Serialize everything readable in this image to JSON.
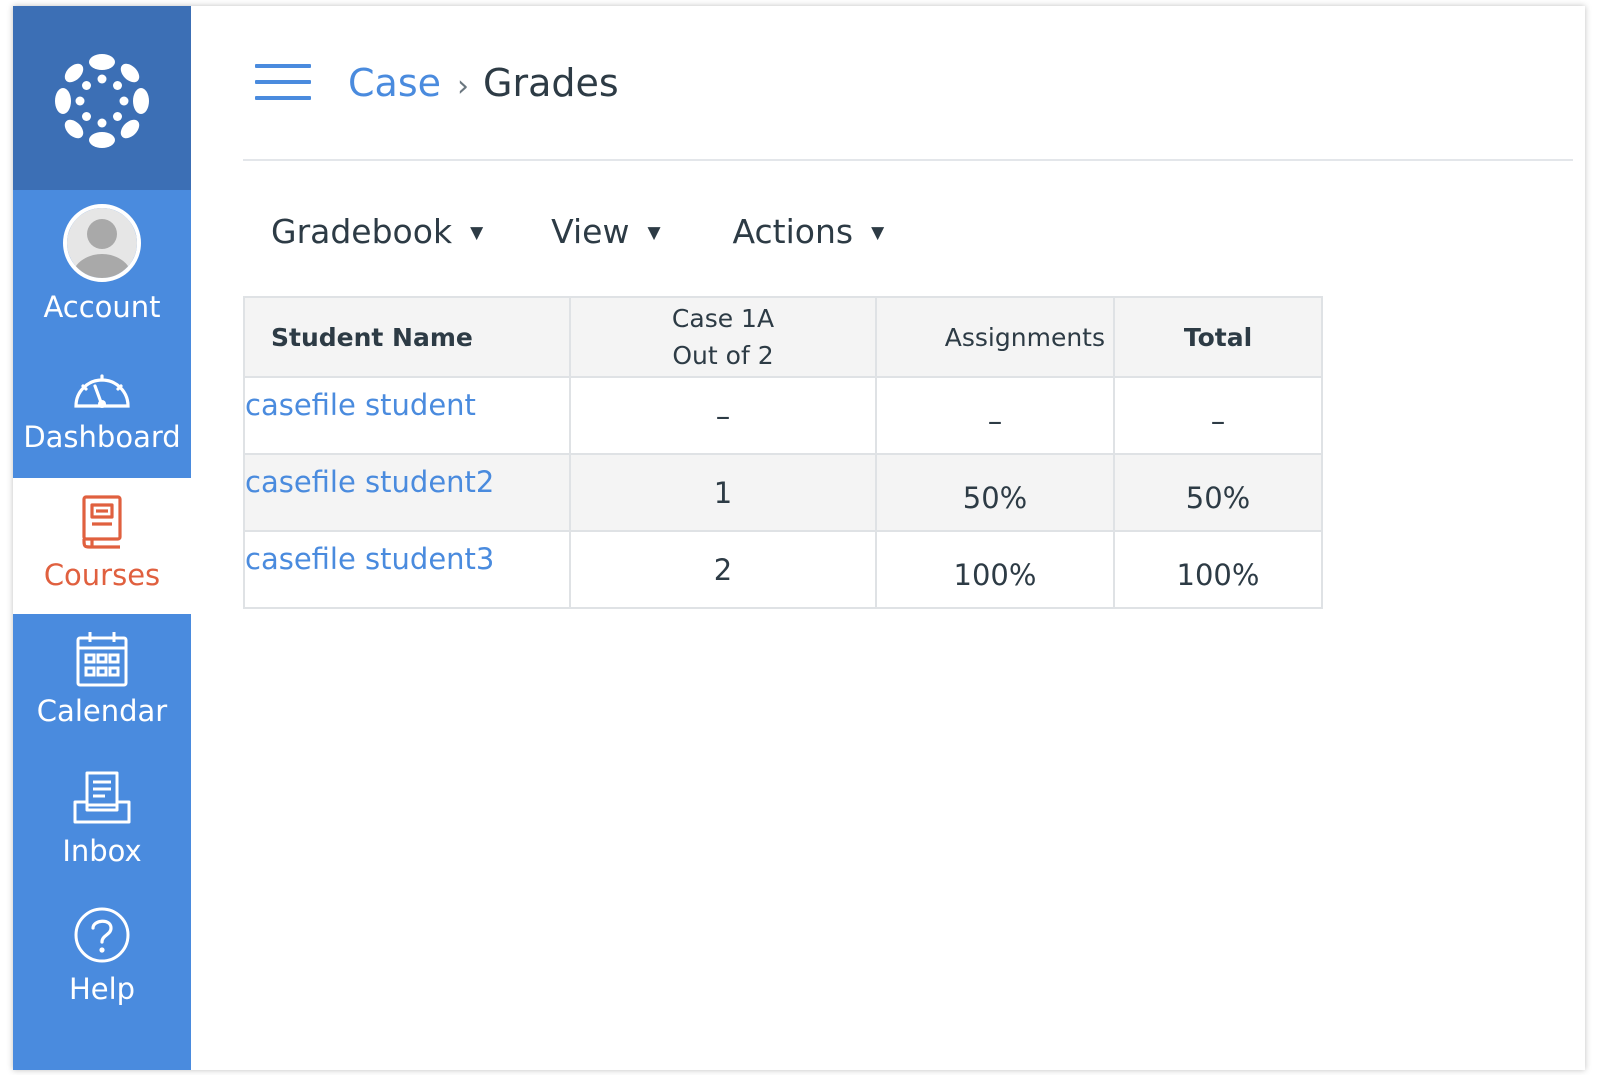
{
  "sidebar": {
    "items": [
      {
        "label": "Account",
        "icon": "avatar-icon"
      },
      {
        "label": "Dashboard",
        "icon": "speedometer-icon"
      },
      {
        "label": "Courses",
        "icon": "book-icon",
        "active": true
      },
      {
        "label": "Calendar",
        "icon": "calendar-icon"
      },
      {
        "label": "Inbox",
        "icon": "inbox-icon"
      },
      {
        "label": "Help",
        "icon": "help-icon"
      }
    ]
  },
  "header": {
    "breadcrumb": {
      "course": "Case",
      "separator": "›",
      "current": "Grades"
    }
  },
  "toolbar": {
    "gradebook_label": "Gradebook",
    "view_label": "View",
    "actions_label": "Actions",
    "caret": "▼"
  },
  "table": {
    "headers": {
      "student_name": "Student Name",
      "assignment_name": "Case 1A",
      "assignment_points": "Out of 2",
      "assignments": "Assignments",
      "total": "Total"
    },
    "rows": [
      {
        "name": "casefile student",
        "case1a": "–",
        "assignments": "–",
        "total": "–"
      },
      {
        "name": "casefile student2",
        "case1a": "1",
        "assignments": "50%",
        "total": "50%"
      },
      {
        "name": "casefile student3",
        "case1a": "2",
        "assignments": "100%",
        "total": "100%"
      }
    ]
  },
  "colors": {
    "sidebar_bg": "#4a8bde",
    "logo_bg": "#3c6fb5",
    "active_accent": "#e0603f",
    "link": "#4a8bde",
    "text": "#2d3b45"
  }
}
